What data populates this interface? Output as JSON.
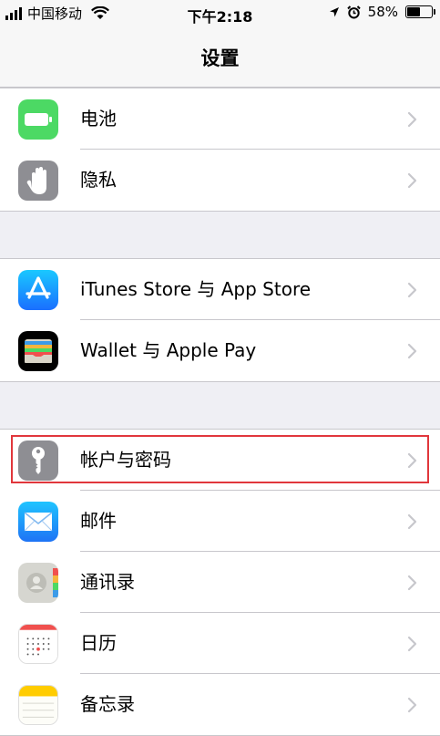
{
  "status_bar": {
    "carrier": "中国移动",
    "time": "下午2:18",
    "battery_percent": "58%",
    "battery_level": 0.58,
    "icons": [
      "signal-icon",
      "wifi-icon",
      "location-icon",
      "alarm-icon",
      "battery-icon"
    ]
  },
  "nav": {
    "title": "设置"
  },
  "groups": [
    {
      "items": [
        {
          "label": "电池",
          "icon": "battery-icon",
          "color": "#4cd964"
        },
        {
          "label": "隐私",
          "icon": "hand-icon",
          "color": "#8e8e93"
        }
      ]
    },
    {
      "items": [
        {
          "label": "iTunes Store 与 App Store",
          "icon": "app-store-icon",
          "color": "#1a8cff"
        },
        {
          "label": "Wallet 与 Apple Pay",
          "icon": "wallet-icon",
          "color": "#000000"
        }
      ]
    },
    {
      "items": [
        {
          "label": "帐户与密码",
          "icon": "key-icon",
          "color": "#8e8e93",
          "highlighted": true
        },
        {
          "label": "邮件",
          "icon": "mail-icon",
          "color": "#1e8ef6"
        },
        {
          "label": "通讯录",
          "icon": "contacts-icon",
          "color": "#c9c9c3"
        },
        {
          "label": "日历",
          "icon": "calendar-icon",
          "color": "#ffffff"
        },
        {
          "label": "备忘录",
          "icon": "notes-icon",
          "color": "#ffcc00"
        }
      ]
    }
  ],
  "colors": {
    "highlight": "#e1373c",
    "separator": "#c8c7cc",
    "background": "#efeff4"
  }
}
